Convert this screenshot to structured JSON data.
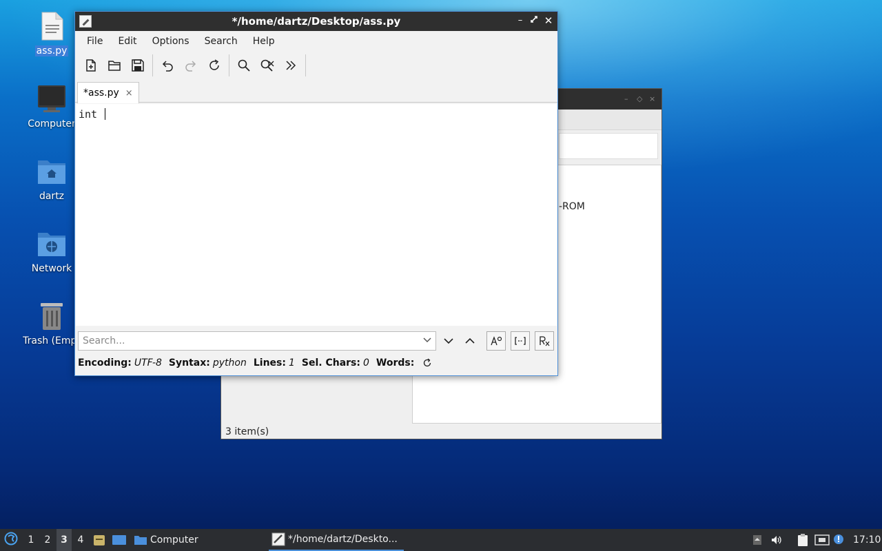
{
  "desktop": {
    "icons": [
      {
        "label": "ass.py",
        "icon": "text-file-icon",
        "selected": true
      },
      {
        "label": "Computer",
        "icon": "computer-icon"
      },
      {
        "label": "dartz",
        "icon": "home-folder-icon"
      },
      {
        "label": "Network",
        "icon": "network-folder-icon"
      },
      {
        "label": "Trash (Empt",
        "icon": "trash-icon"
      }
    ]
  },
  "file_manager": {
    "partial_text": "-ROM",
    "status": "3 item(s)"
  },
  "editor": {
    "title": "*/home/dartz/Desktop/ass.py",
    "menu": [
      "File",
      "Edit",
      "Options",
      "Search",
      "Help"
    ],
    "toolbar": [
      "new-file-icon",
      "open-folder-icon",
      "save-icon",
      "undo-icon",
      "redo-icon",
      "reload-icon",
      "find-icon",
      "find-replace-icon",
      "go-to-line-icon"
    ],
    "tab_label": "*ass.py",
    "tab_close": "×",
    "content": "int ",
    "search": {
      "placeholder": "Search..."
    },
    "status": {
      "encoding_label": "Encoding:",
      "encoding": "UTF-8",
      "syntax_label": "Syntax:",
      "syntax": "python",
      "lines_label": "Lines:",
      "lines": "1",
      "selchars_label": "Sel. Chars:",
      "selchars": "0",
      "words_label": "Words:"
    }
  },
  "taskbar": {
    "workspaces": [
      "1",
      "2",
      "3",
      "4"
    ],
    "active_workspace": "3",
    "tasks": [
      {
        "label": "Computer",
        "icon": "folder-icon"
      },
      {
        "label": "*/home/dartz/Deskto...",
        "icon": "text-editor-icon",
        "active": true
      }
    ],
    "clock": "17:10"
  }
}
